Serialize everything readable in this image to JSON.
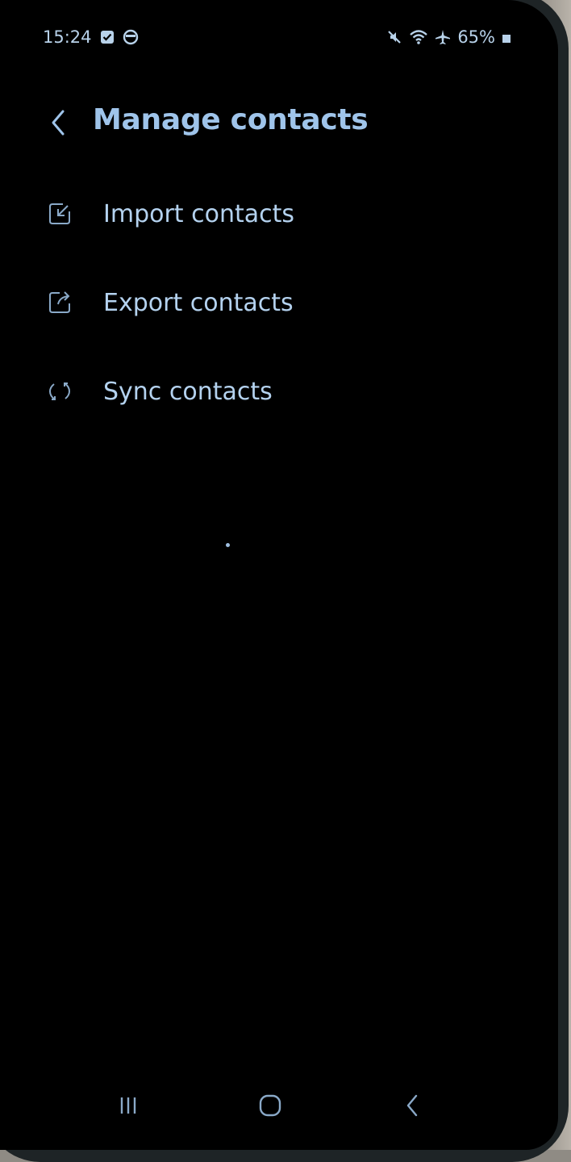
{
  "status_bar": {
    "time": "15:24",
    "battery": "65%",
    "icons": [
      "checkbox-notification-icon",
      "circle-notification-icon",
      "mute-icon",
      "wifi-icon",
      "airplane-icon",
      "battery-icon"
    ]
  },
  "header": {
    "title": "Manage contacts",
    "back_icon": "back-chevron-icon"
  },
  "menu": {
    "items": [
      {
        "label": "Import contacts",
        "icon": "import-icon"
      },
      {
        "label": "Export contacts",
        "icon": "export-icon"
      },
      {
        "label": "Sync contacts",
        "icon": "sync-icon"
      }
    ]
  },
  "nav_bar": {
    "icons": [
      "recents-icon",
      "home-icon",
      "back-icon"
    ]
  },
  "colors": {
    "background": "#000000",
    "title": "#9fc4ea",
    "text": "#b4d2ef",
    "icon": "#8aa9c8"
  }
}
